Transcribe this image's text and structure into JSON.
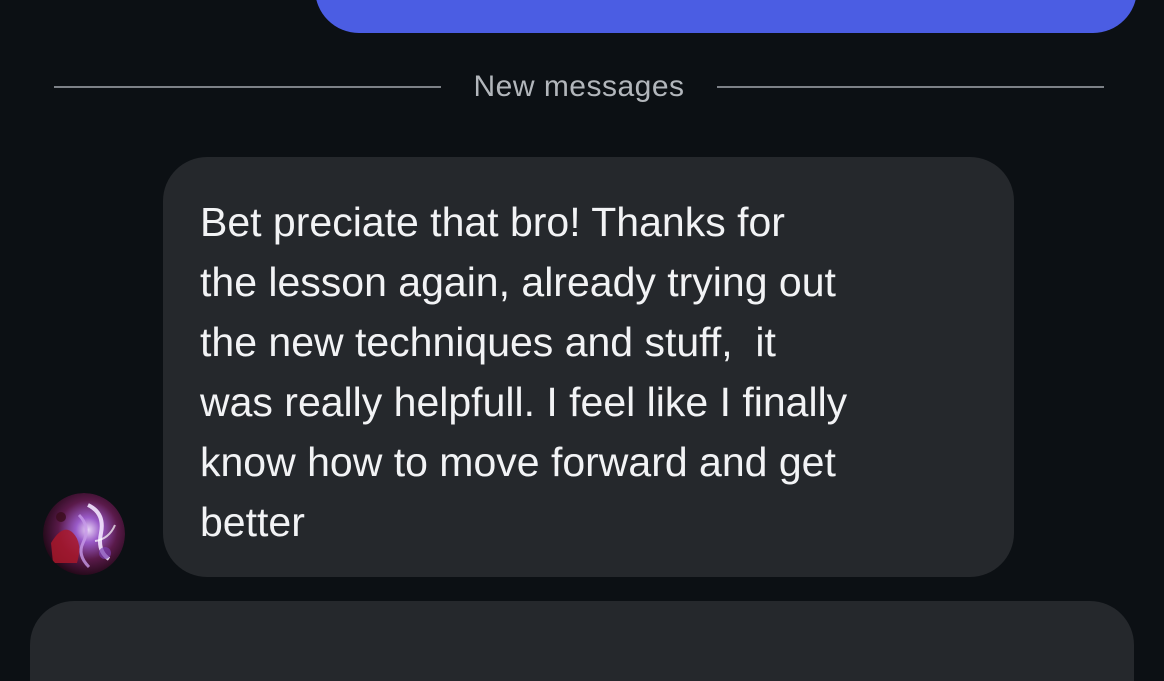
{
  "divider": {
    "label": "New messages"
  },
  "received_message": {
    "text": "Bet preciate that bro! Thanks for\nthe lesson again, already trying out\nthe new techniques and stuff,  it\nwas really helpfull. I feel like I finally\nknow how to move forward and get\nbetter"
  },
  "avatar": {
    "icon": "user-avatar-icon"
  },
  "colors": {
    "background": "#0c1014",
    "sent_bubble": "#4b5de3",
    "received_bubble": "#25282c",
    "divider_line": "#7d8187",
    "divider_text": "#b2b6bb",
    "message_text": "#f2f3f5"
  }
}
